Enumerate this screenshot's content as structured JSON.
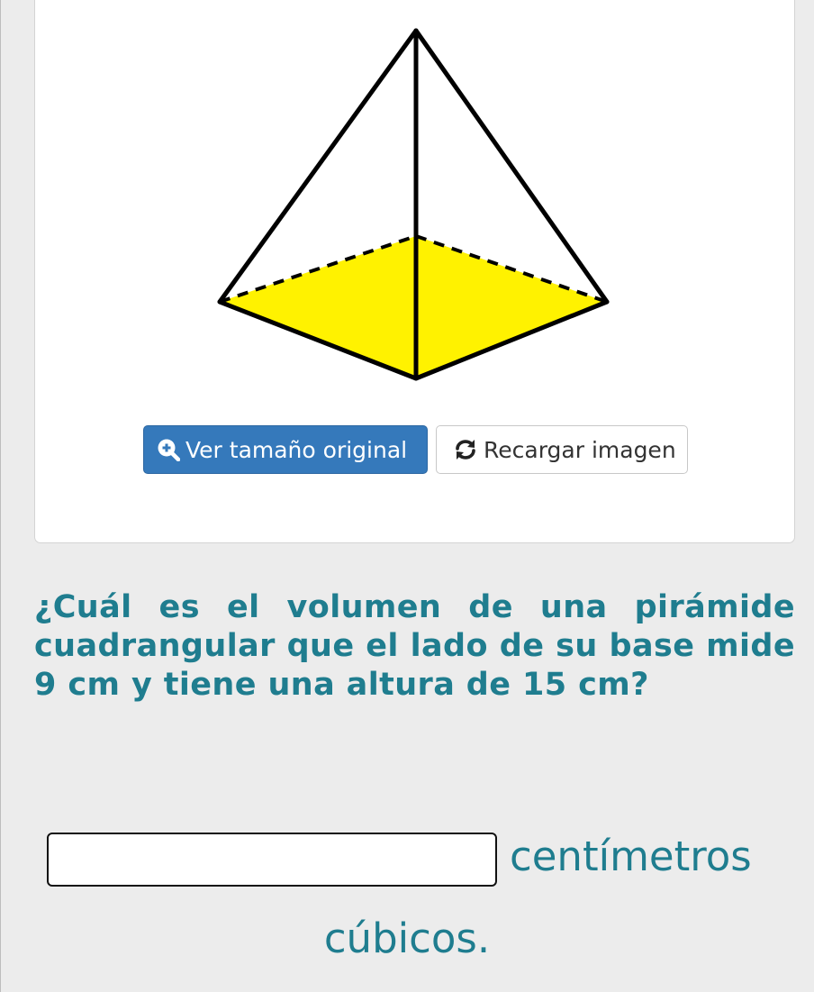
{
  "figure": {
    "base_color": "#fff200",
    "edge_color": "#000000"
  },
  "buttons": {
    "zoom_label": "Ver tamaño original",
    "zoom_icon": "search-plus-icon",
    "reload_label": "Recargar imagen",
    "reload_icon": "refresh-icon"
  },
  "question": {
    "text": "¿Cuál es el volumen de una pirámide cuadrangular que el lado de su base mide 9 cm y tiene una altura de 15 cm?"
  },
  "answer": {
    "value": "",
    "placeholder": "",
    "unit_line1": "centímetros",
    "unit_line2": "cúbicos."
  },
  "colors": {
    "accent": "#1f7d8f",
    "primary_button": "#3579bb",
    "background": "#ececec"
  }
}
